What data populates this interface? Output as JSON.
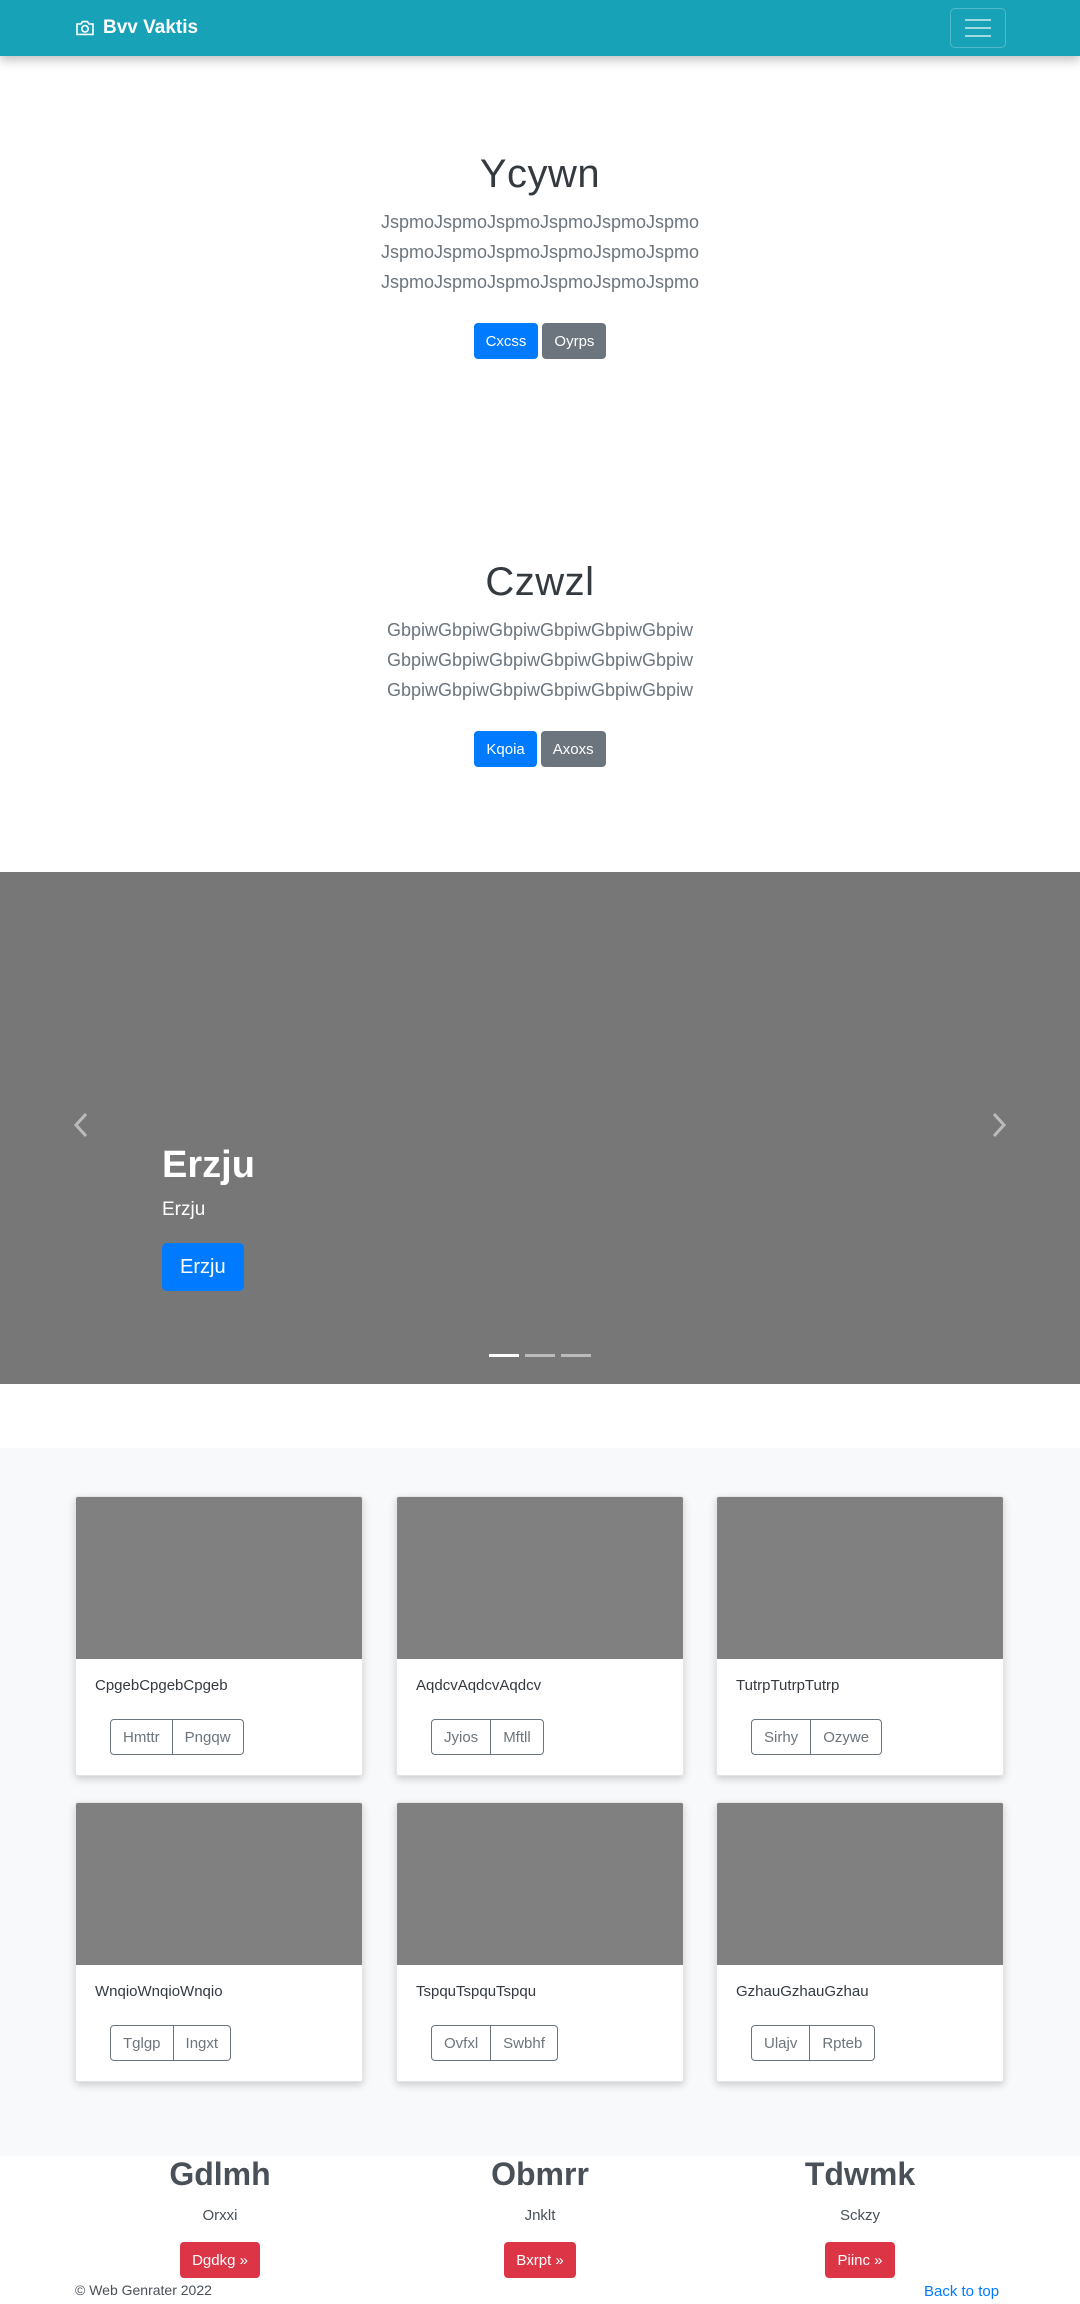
{
  "navbar": {
    "brand": "Bvv Vaktis",
    "brand_icon": "camera-icon",
    "toggler_icon": "hamburger-icon"
  },
  "jumbotrons": [
    {
      "title": "Ycywn",
      "lines": [
        "JspmoJspmoJspmoJspmoJspmoJspmo",
        "JspmoJspmoJspmoJspmoJspmoJspmo",
        "JspmoJspmoJspmoJspmoJspmoJspmo"
      ],
      "primary": "Cxcss",
      "secondary": "Oyrps"
    },
    {
      "title": "Czwzl",
      "lines": [
        "GbpiwGbpiwGbpiwGbpiwGbpiwGbpiw",
        "GbpiwGbpiwGbpiwGbpiwGbpiwGbpiw",
        "GbpiwGbpiwGbpiwGbpiwGbpiwGbpiw"
      ],
      "primary": "Kqoia",
      "secondary": "Axoxs"
    }
  ],
  "carousel": {
    "heading": "Erzju",
    "text": "Erzju",
    "button": "Erzju",
    "slide_count": 3,
    "active_slide": 1
  },
  "cards": [
    {
      "text": "CpgebCpgebCpgeb",
      "btn1": "Hmttr",
      "btn2": "Pngqw"
    },
    {
      "text": "AqdcvAqdcvAqdcv",
      "btn1": "Jyios",
      "btn2": "Mftll"
    },
    {
      "text": "TutrpTutrpTutrp",
      "btn1": "Sirhy",
      "btn2": "Ozywe"
    },
    {
      "text": "WnqioWnqioWnqio",
      "btn1": "Tglgp",
      "btn2": "Ingxt"
    },
    {
      "text": "TspquTspquTspqu",
      "btn1": "Ovfxl",
      "btn2": "Swbhf"
    },
    {
      "text": "GzhauGzhauGzhau",
      "btn1": "Ulajv",
      "btn2": "Rpteb"
    }
  ],
  "columns": [
    {
      "heading": "Gdlmh",
      "text": "Orxxi",
      "button": "Dgdkg »"
    },
    {
      "heading": "Obmrr",
      "text": "Jnklt",
      "button": "Bxrpt »"
    },
    {
      "heading": "Tdwmk",
      "text": "Sckzy",
      "button": "Piinc »"
    }
  ],
  "footer": {
    "copyright": "© Web Genrater 2022",
    "back_to_top": "Back to top"
  },
  "colors": {
    "navbar": "#17a2b8",
    "primary": "#007bff",
    "secondary": "#6c757d",
    "danger": "#dc3545",
    "placeholder": "#808080"
  }
}
